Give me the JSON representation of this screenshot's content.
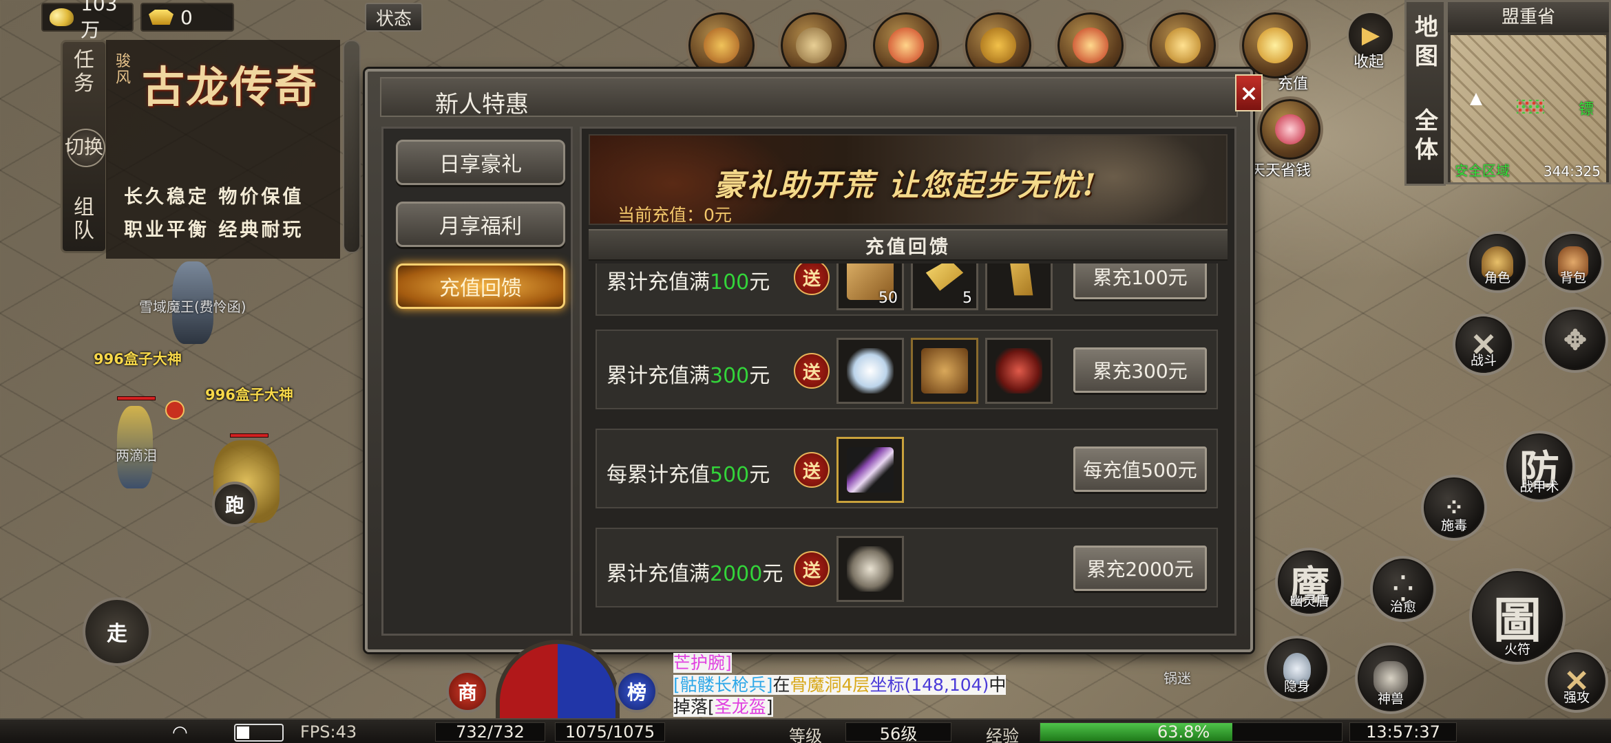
{
  "top_bar": {
    "gold": "103万",
    "ingots": "0",
    "status_label": "状态"
  },
  "top_icons": {
    "labels": [
      "充值",
      "天天省钱",
      "收起"
    ]
  },
  "left_panel": {
    "tabs": [
      "任务",
      "切换",
      "组队"
    ],
    "logo_small": "骏风",
    "logo_text": "古龙传奇",
    "lines": [
      "长久稳定 物价保值",
      "职业平衡 经典耐玩"
    ]
  },
  "world": {
    "names": [
      "雪域魔王(费怜函)",
      "996盒子大神",
      "996盒子大神",
      "两滴泪",
      "锅迷"
    ],
    "run_label": "跑",
    "walk_label": "走"
  },
  "dialog": {
    "title": "新人特惠",
    "close": "×",
    "menu": [
      "日享豪礼",
      "月享福利",
      "充值回馈"
    ],
    "active_menu": "充值回馈",
    "banner_text": "豪礼助开荒 让您起步无忧!",
    "current_charge": "当前充值：0元",
    "section_header": "充值回馈",
    "badge": "送",
    "rows": [
      {
        "prefix": "累计充值满",
        "amount": "100",
        "suffix": "元",
        "items": [
          {
            "icon": "scroll-item-icon",
            "count": "50"
          },
          {
            "icon": "gold-bar-icon",
            "count": "5"
          },
          {
            "icon": "gold-scroll-icon",
            "count": ""
          }
        ],
        "button": "累充100元"
      },
      {
        "prefix": "累计充值满",
        "amount": "300",
        "suffix": "元",
        "items": [
          {
            "icon": "silver-pile-icon",
            "count": ""
          },
          {
            "icon": "armor-icon",
            "count": ""
          },
          {
            "icon": "red-crest-icon",
            "count": ""
          }
        ],
        "button": "累充300元"
      },
      {
        "prefix": "每累计充值",
        "amount": "500",
        "suffix": "元",
        "items": [
          {
            "icon": "purple-flute-icon",
            "count": ""
          }
        ],
        "button": "每充值500元"
      },
      {
        "prefix": "累计充值满",
        "amount": "2000",
        "suffix": "元",
        "items": [
          {
            "icon": "beast-head-icon",
            "count": ""
          }
        ],
        "button": "累充2000元"
      }
    ]
  },
  "minimap": {
    "side_tabs": [
      "地图",
      "全体"
    ],
    "region": "盟重省",
    "safe_zone": "安全区域",
    "coords": "344:325",
    "edge_text": "镖"
  },
  "skills": {
    "role": "角色",
    "bag": "背包",
    "fight": "战斗",
    "defense": "防",
    "defense_label": "战甲术",
    "poison_label": "施毒",
    "ghost": "魔",
    "ghost_label": "幽灵盾",
    "heal_label": "治愈",
    "talisman": "圖",
    "talisman_label": "火符",
    "stealth_label": "隐身",
    "beast_label": "神兽",
    "attack_label": "强攻"
  },
  "chat": {
    "line1": "芒护腕]",
    "line2_a": "[骷髅长枪兵]",
    "line2_b": "在",
    "line2_c": "骨魔洞4层",
    "line2_d": "坐标(148,104)",
    "line2_e": "中",
    "line3_a": "掉落[",
    "line3_b": "圣龙盔",
    "line3_c": "]"
  },
  "hud": {
    "shop": "商",
    "rank": "榜",
    "fps": "FPS:43",
    "hp": "732/732",
    "mp": "1075/1075",
    "level_label": "等级",
    "level": "56级",
    "exp_label": "经验",
    "exp_percent": "63.8%",
    "exp_fraction": 0.638,
    "time": "13:57:37"
  },
  "colors": {
    "amount_green": "#33d43a",
    "safe_zone_green": "#35e23a",
    "active_menu_orange": "#f4b546"
  }
}
